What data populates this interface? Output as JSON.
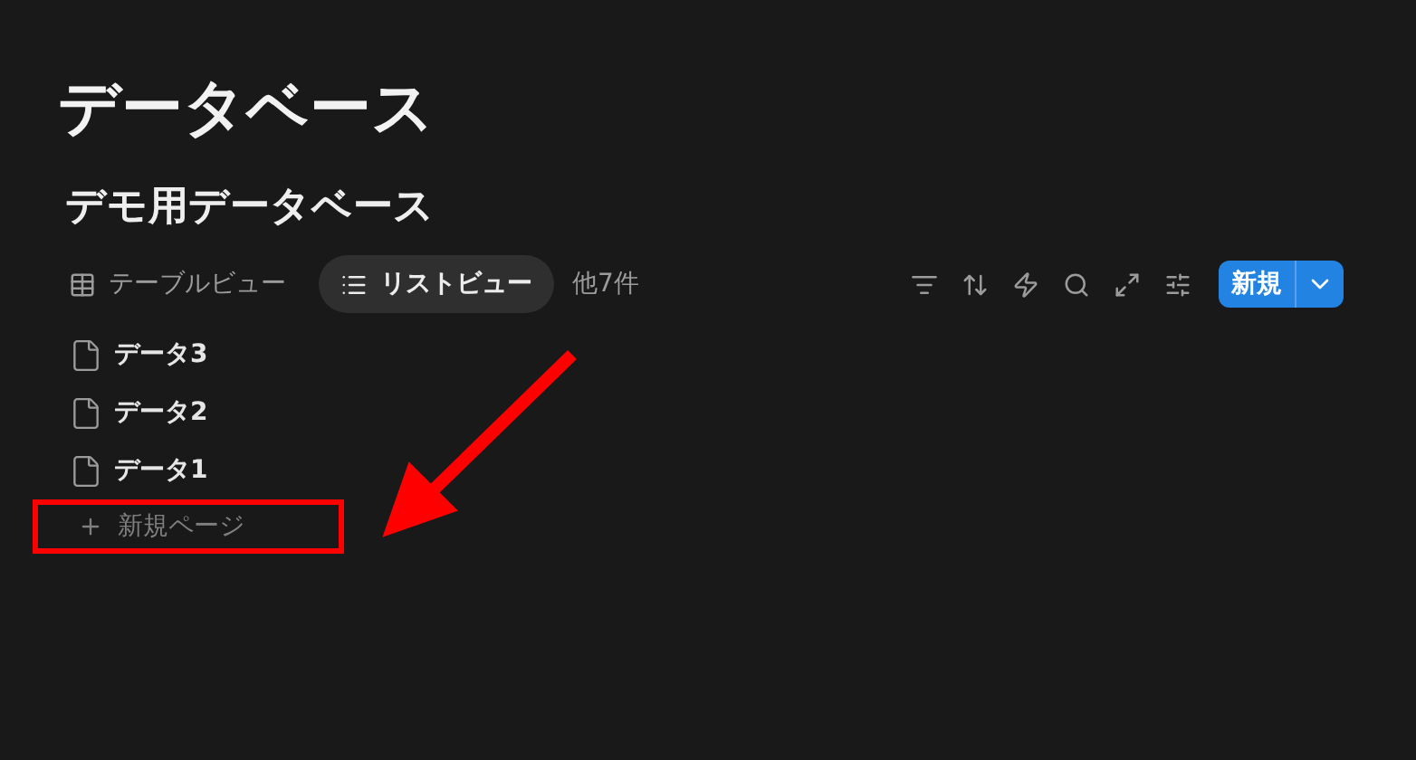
{
  "page": {
    "title": "データベース"
  },
  "database": {
    "title": "デモ用データベース",
    "views": [
      {
        "label": "テーブルビュー",
        "kind": "table",
        "selected": false
      },
      {
        "label": "リストビュー",
        "kind": "list",
        "selected": true
      }
    ],
    "more_views": "他7件",
    "new_button": {
      "label": "新規"
    },
    "items": [
      {
        "title": "データ3"
      },
      {
        "title": "データ2"
      },
      {
        "title": "データ1"
      }
    ],
    "new_page": {
      "label": "新規ページ",
      "highlighted": true
    }
  }
}
